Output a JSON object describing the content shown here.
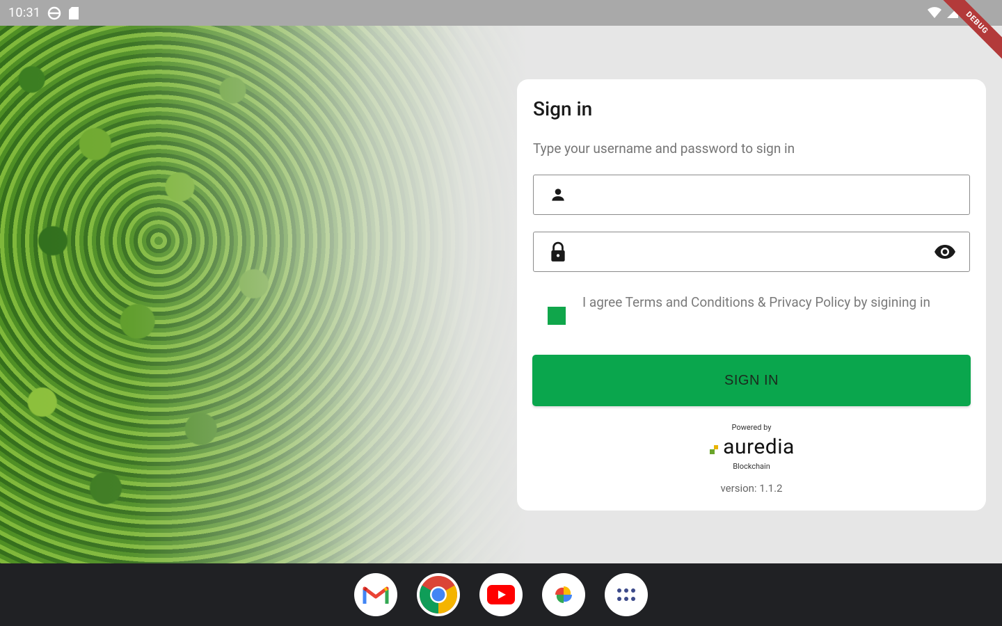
{
  "status_bar": {
    "time": "10:31",
    "left_icons": [
      "vpn-globe-icon",
      "sd-card-icon"
    ],
    "right_icons": [
      "wifi-icon",
      "signal-icon",
      "battery-icon"
    ],
    "debug_banner": "DEBUG"
  },
  "login": {
    "title": "Sign in",
    "subtitle": "Type your username and password to sign in",
    "username": {
      "icon": "person-icon",
      "value": "",
      "placeholder": ""
    },
    "password": {
      "icon": "lock-icon",
      "value": "",
      "placeholder": "",
      "toggle_icon": "eye-icon"
    },
    "agree": {
      "checked": true,
      "text": "I agree Terms and Conditions & Privacy Policy by sigining in"
    },
    "submit_label": "SIGN IN",
    "powered_by": "Powered by",
    "brand_name": "auredia",
    "brand_sub": "Blockchain",
    "version": "version:  1.1.2"
  },
  "colors": {
    "accent": "#0aa64d",
    "checkbox": "#10a64b",
    "status_bar": "#a9a9a9",
    "taskbar": "#202124"
  },
  "taskbar": {
    "apps": [
      {
        "name": "Gmail",
        "icon": "gmail-icon"
      },
      {
        "name": "Chrome",
        "icon": "chrome-icon"
      },
      {
        "name": "YouTube",
        "icon": "youtube-icon"
      },
      {
        "name": "Photos",
        "icon": "photos-icon"
      },
      {
        "name": "App drawer",
        "icon": "app-drawer-icon"
      }
    ]
  }
}
